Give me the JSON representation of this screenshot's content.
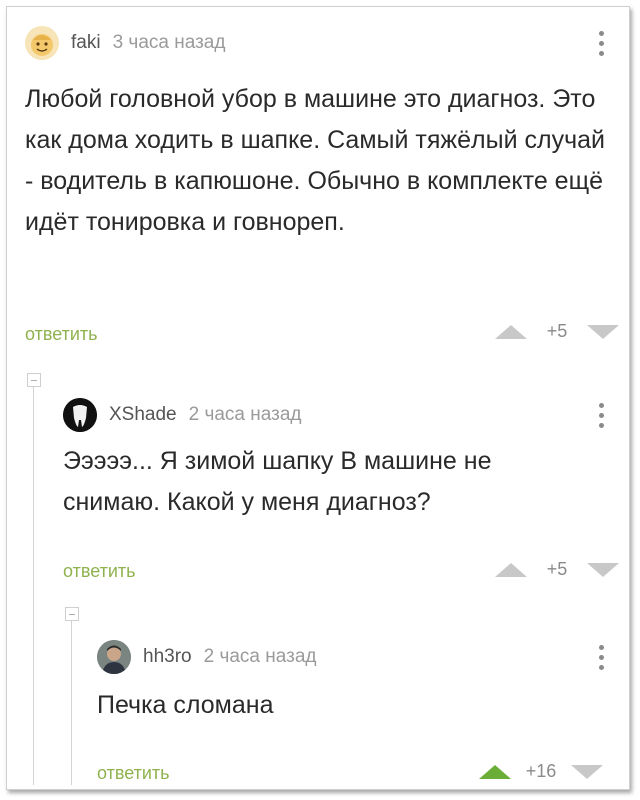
{
  "comments": [
    {
      "username": "faki",
      "time": "3 часа назад",
      "text": "Любой головной убор в машине это диагноз. Это как дома ходить в шапке. Самый тяжёлый случай - водитель в капюшоне. Обычно в комплекте ещё идёт тонировка и говнореп.",
      "reply_label": "ответить",
      "rating": "+5",
      "upvoted": false
    },
    {
      "username": "XShade",
      "time": "2 часа назад",
      "text": "Эээээ... Я зимой шапку В машине не снимаю. Какой у меня диагноз?",
      "reply_label": "ответить",
      "rating": "+5",
      "upvoted": false
    },
    {
      "username": "hh3ro",
      "time": "2 часа назад",
      "text": "Печка сломана",
      "reply_label": "ответить",
      "rating": "+16",
      "upvoted": true
    }
  ],
  "icons": {
    "more": "more-vertical-icon",
    "upvote": "triangle-up-icon",
    "downvote": "triangle-down-icon",
    "collapse": "collapse-minus-icon"
  },
  "colors": {
    "reply": "#8fb24e",
    "upvote_active": "#6aae38",
    "vote_inactive": "#c8c8c8"
  }
}
